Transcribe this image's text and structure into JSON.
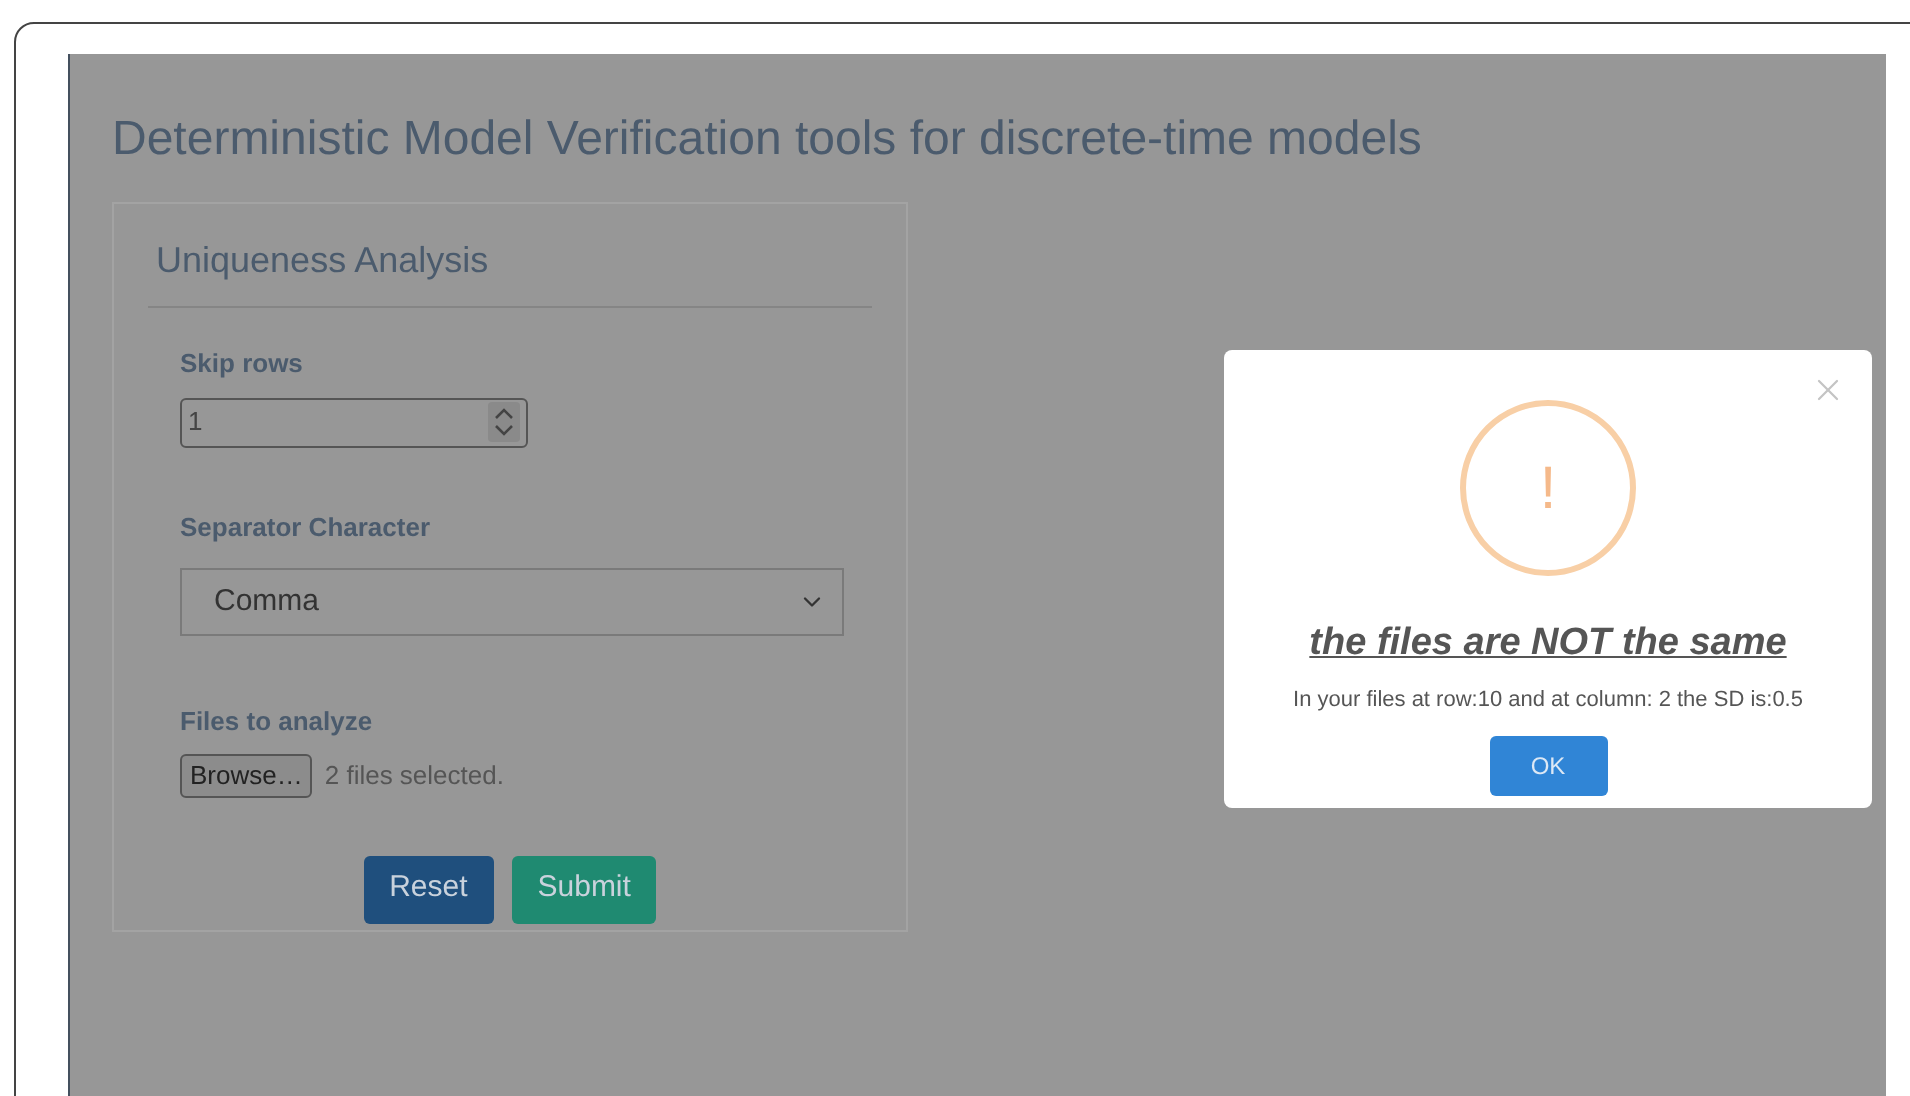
{
  "page_title": "Deterministic Model Verification tools for discrete-time models",
  "card": {
    "title": "Uniqueness Analysis",
    "skip_rows": {
      "label": "Skip rows",
      "value": "1"
    },
    "separator": {
      "label": "Separator Character",
      "value": "Comma"
    },
    "files": {
      "label": "Files to analyze",
      "button": "Browse…",
      "status": "2 files selected."
    },
    "buttons": [
      {
        "label": "Reset",
        "kind": "reset"
      },
      {
        "label": "Submit",
        "kind": "submit"
      }
    ]
  },
  "modal": {
    "icon_text": "!",
    "title": "the files are NOT the same",
    "message": "In your files at row:10 and at column: 2 the SD is:0.5",
    "button": "OK"
  }
}
